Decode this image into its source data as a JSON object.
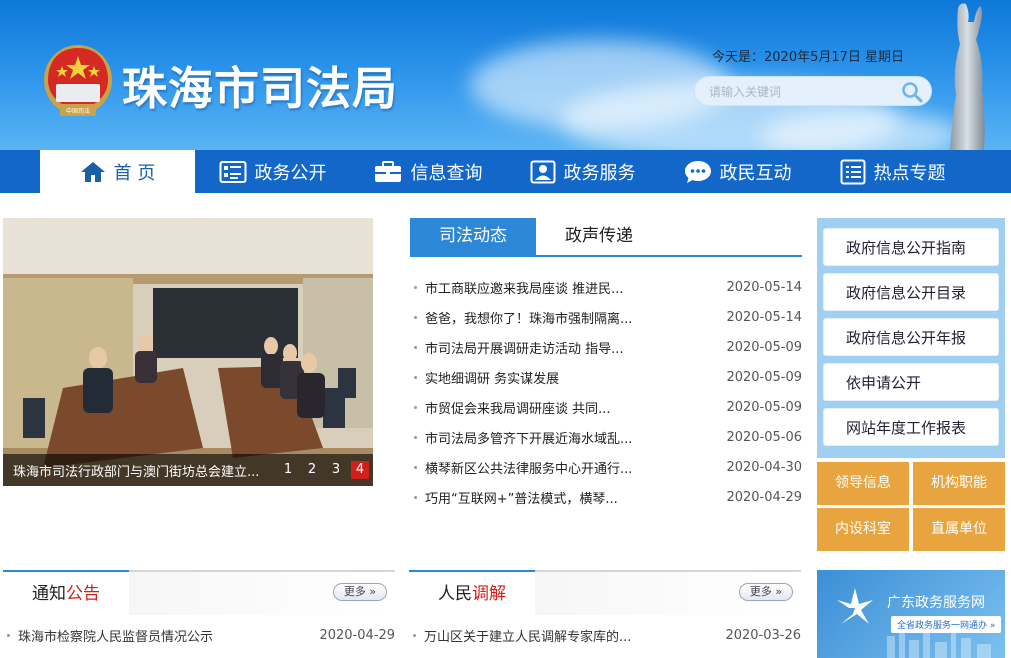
{
  "header": {
    "site_title": "珠海市司法局",
    "emblem_text": "中国司法",
    "date_text": "今天是：2020年5月17日 星期日",
    "search_placeholder": "请输入关键词"
  },
  "nav": {
    "items": [
      {
        "label": "首 页",
        "icon": "home-icon",
        "active": true
      },
      {
        "label": "政务公开",
        "icon": "document-list-icon"
      },
      {
        "label": "信息查询",
        "icon": "briefcase-icon"
      },
      {
        "label": "政务服务",
        "icon": "user-card-icon"
      },
      {
        "label": "政民互动",
        "icon": "chat-bubble-icon"
      },
      {
        "label": "热点专题",
        "icon": "list-icon"
      }
    ]
  },
  "slider": {
    "caption": "珠海市司法行政部门与澳门街坊总会建立...",
    "dots": [
      "1",
      "2",
      "3",
      "4"
    ],
    "active_dot": "4"
  },
  "news": {
    "tabs": [
      "司法动态",
      "政声传递"
    ],
    "active_tab": "司法动态",
    "items": [
      {
        "title": "市工商联应邀来我局座谈 推进民...",
        "date": "2020-05-14"
      },
      {
        "title": "爸爸，我想你了！珠海市强制隔离...",
        "date": "2020-05-14"
      },
      {
        "title": "市司法局开展调研走访活动 指导...",
        "date": "2020-05-09"
      },
      {
        "title": "实地细调研 务实谋发展",
        "date": "2020-05-09"
      },
      {
        "title": "市贸促会来我局调研座谈 共同...",
        "date": "2020-05-09"
      },
      {
        "title": "市司法局多管齐下开展近海水域乱...",
        "date": "2020-05-06"
      },
      {
        "title": "横琴新区公共法律服务中心开通行...",
        "date": "2020-04-30"
      },
      {
        "title": "巧用“互联网+”普法模式，横琴...",
        "date": "2020-04-29"
      }
    ]
  },
  "right_panel": {
    "buttons": [
      "政府信息公开指南",
      "政府信息公开目录",
      "政府信息公开年报",
      "依申请公开",
      "网站年度工作报表"
    ],
    "grid": [
      "领导信息",
      "机构职能",
      "内设科室",
      "直属单位"
    ]
  },
  "notice_panel": {
    "title_a": "通知",
    "title_b": "公告",
    "more": "更多",
    "items": [
      {
        "title": "珠海市检察院人民监督员情况公示",
        "date": "2020-04-29"
      }
    ]
  },
  "mediation_panel": {
    "title_a": "人民",
    "title_b": "调解",
    "more": "更多",
    "items": [
      {
        "title": "万山区关于建立人民调解专家库的...",
        "date": "2020-03-26"
      }
    ]
  },
  "gd_banner": {
    "title": "广东政务服务网",
    "subtitle": "全省政务服务一网通办 »"
  },
  "colors": {
    "nav_bg": "#1267c9",
    "tab_active": "#2c87d6",
    "accent_red": "#d0201c",
    "grid_orange": "#e7a43f",
    "right_panel_bg": "#9fd0f2"
  }
}
